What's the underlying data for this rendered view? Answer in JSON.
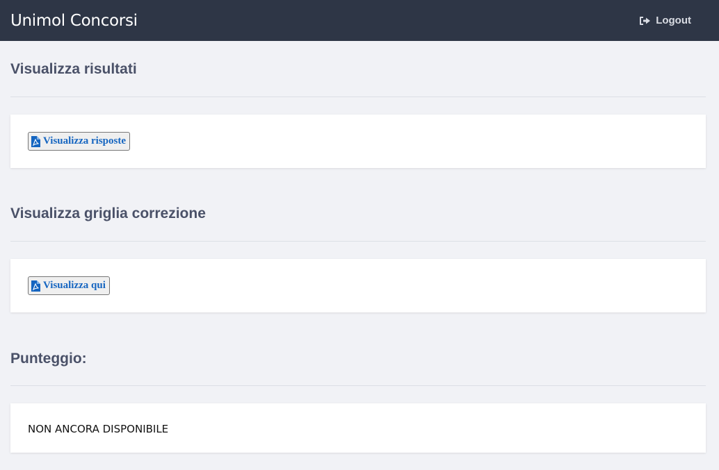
{
  "app": {
    "title": "Unimol Concorsi",
    "logout_label": "Logout"
  },
  "sections": {
    "results": {
      "title": "Visualizza risultati",
      "button_label": "Visualizza risposte"
    },
    "grid": {
      "title": "Visualizza griglia correzione",
      "button_label": "Visualizza qui"
    },
    "score": {
      "title": "Punteggio:",
      "value": "NON ANCORA DISPONIBILE"
    }
  },
  "icons": {
    "logout": "sign-out-icon",
    "pdf": "file-pdf-icon"
  },
  "colors": {
    "topbar": "#2e3646",
    "background": "#f1f2f6",
    "heading": "#4a5168",
    "link": "#1565c0"
  }
}
